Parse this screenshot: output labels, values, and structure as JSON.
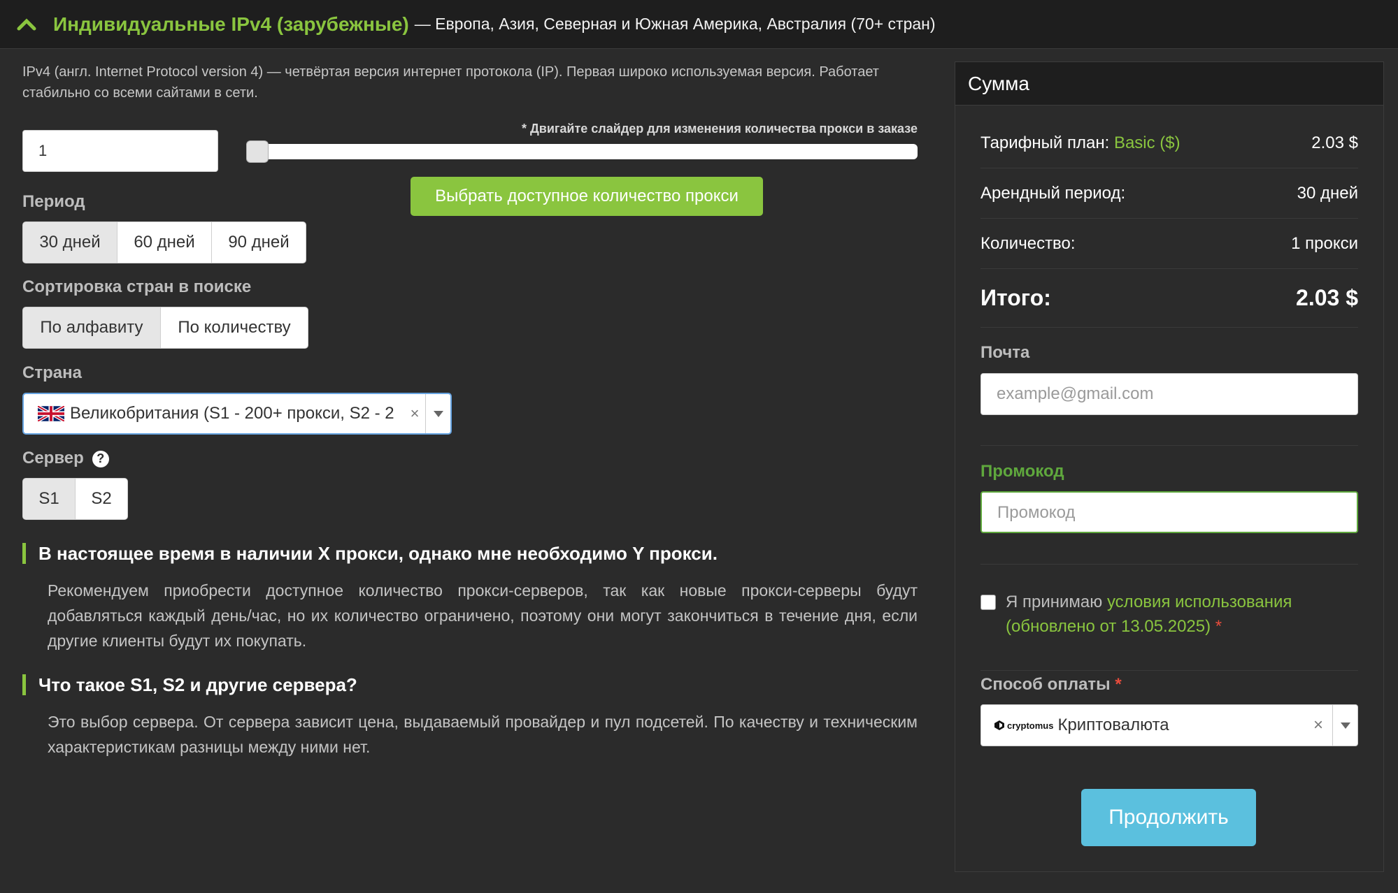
{
  "header": {
    "title": "Индивидуальные IPv4 (зарубежные)",
    "subtitle": "— Европа, Азия, Северная и Южная Америка, Австралия (70+ стран)"
  },
  "left": {
    "description": "IPv4 (англ. Internet Protocol version 4) — четвёртая версия интернет протокола (IP). Первая широко используемая версия. Работает стабильно со всеми сайтами в сети.",
    "slider_note": "* Двигайте слайдер для изменения количества прокси в заказе",
    "quantity_value": "1",
    "avail_button": "Выбрать доступное количество прокси",
    "period_label": "Период",
    "periods": [
      "30 дней",
      "60 дней",
      "90 дней"
    ],
    "sort_label": "Сортировка стран в поиске",
    "sort_options": [
      "По алфавиту",
      "По количеству"
    ],
    "country_label": "Страна",
    "country_value": "Великобритания (S1 - 200+ прокси, S2 - 2",
    "server_label": "Сервер",
    "servers": [
      "S1",
      "S2"
    ],
    "faq": [
      {
        "q": "В настоящее время в наличии X прокси, однако мне необходимо Y прокси.",
        "a": "Рекомендуем приобрести доступное количество прокси-серверов, так как новые прокси-серверы будут добавляться каждый день/час, но их количество ограничено, поэтому они могут закончиться в течение дня, если другие клиенты будут их покупать."
      },
      {
        "q": "Что такое S1, S2 и другие сервера?",
        "a": "Это выбор сервера. От сервера зависит цена, выдаваемый провайдер и пул подсетей. По качеству и техническим характеристикам разницы между ними нет."
      }
    ]
  },
  "summary": {
    "title": "Сумма",
    "plan_label": "Тарифный план:",
    "plan_name": "Basic ($)",
    "plan_price": "2.03 $",
    "period_label": "Арендный период:",
    "period_value": "30 дней",
    "qty_label": "Количество:",
    "qty_value": "1 прокси",
    "total_label": "Итого:",
    "total_value": "2.03 $",
    "email_label": "Почта",
    "email_placeholder": "example@gmail.com",
    "promo_label": "Промокод",
    "promo_placeholder": "Промокод",
    "terms_prefix": "Я принимаю",
    "terms_link": "условия использования (обновлено от 13.05.2025)",
    "terms_star": "*",
    "payment_label": "Способ оплаты",
    "payment_star": "*",
    "payment_logo": "cryptomus",
    "payment_value": "Криптовалюта",
    "clear_symbol": "×",
    "continue_button": "Продолжить"
  },
  "colors": {
    "accent_green": "#8ac53f",
    "continue_blue": "#5bc0de",
    "background": "#2b2b2b"
  }
}
